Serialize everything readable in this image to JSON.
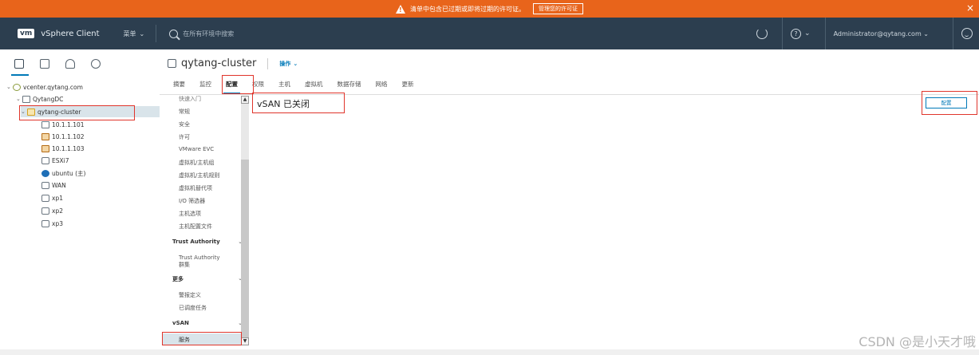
{
  "banner": {
    "message": "清单中包含已过期或即将过期的许可证。",
    "button": "管理您的许可证",
    "close": "×"
  },
  "topbar": {
    "logo": "vm",
    "app_title": "vSphere Client",
    "menu_label": "菜单",
    "search_placeholder": "在所有环境中搜索",
    "user": "Administrator@qytang.com"
  },
  "tree": [
    {
      "label": "vcenter.qytang.com",
      "icon": "vcenter-icon",
      "expanded": true
    },
    {
      "label": "QytangDC",
      "icon": "datacenter-icon",
      "expanded": true
    },
    {
      "label": "qytang-cluster",
      "icon": "cluster-icon",
      "expanded": true,
      "selected": true
    },
    {
      "label": "10.1.1.101",
      "icon": "host-icon"
    },
    {
      "label": "10.1.1.102",
      "icon": "host-warning-icon"
    },
    {
      "label": "10.1.1.103",
      "icon": "host-warning-icon"
    },
    {
      "label": "ESXi7",
      "icon": "vm-icon"
    },
    {
      "label": "ubuntu (主)",
      "icon": "vm-on-icon"
    },
    {
      "label": "WAN",
      "icon": "vm-icon"
    },
    {
      "label": "xp1",
      "icon": "vm-icon"
    },
    {
      "label": "xp2",
      "icon": "vm-icon"
    },
    {
      "label": "xp3",
      "icon": "vm-icon"
    }
  ],
  "object": {
    "name": "qytang-cluster",
    "actions": "操作"
  },
  "tabs": [
    "摘要",
    "监控",
    "配置",
    "权限",
    "主机",
    "虚拟机",
    "数据存储",
    "网络",
    "更新"
  ],
  "active_tab": "配置",
  "subnav": {
    "items_top": [
      "快速入门",
      "常规",
      "安全",
      "许可",
      "VMware EVC",
      "虚拟机/主机组",
      "虚拟机/主机规则",
      "虚拟机替代项",
      "I/O 筛选器",
      "主机选项",
      "主机配置文件"
    ],
    "section_trust": "Trust Authority",
    "trust_item_line1": "Trust Authority",
    "trust_item_line2": "群集",
    "section_more": "更多",
    "more_items": [
      "警报定义",
      "已调度任务"
    ],
    "section_vsan": "vSAN",
    "vsan_items": [
      "服务"
    ]
  },
  "content": {
    "vsan_status": "vSAN 已关闭",
    "configure_button": "配置"
  },
  "watermark": "CSDN @是小天才哦"
}
